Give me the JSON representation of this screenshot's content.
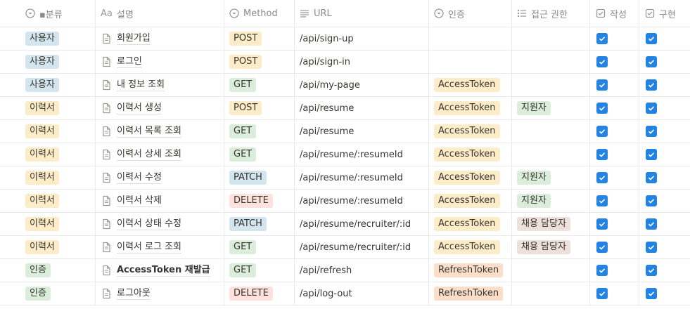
{
  "headers": {
    "category": "▪분류",
    "name": "설명",
    "method": "Method",
    "url": "URL",
    "auth": "인증",
    "access": "접근 권한",
    "written": "작성",
    "implemented": "구현"
  },
  "header_icon_text": {
    "name": "Aa"
  },
  "colors": {
    "사용자": "#d3e5ef",
    "이력서": "#fdecc8",
    "인증": "#dbeddb",
    "POST": "#fdecc8",
    "GET": "#dbeddb",
    "PATCH": "#d3e5ef",
    "DELETE": "#ffe2dd",
    "AccessToken": "#fdecc8",
    "RefreshToken": "#fadec9",
    "지원자": "#dbeddb",
    "채용 담당자": "#eee0da",
    "check": "#2383e2"
  },
  "rows": [
    {
      "category": "사용자",
      "name": "회원가입",
      "method": "POST",
      "url": "/api/sign-up",
      "auth": "",
      "access": "",
      "written": true,
      "implemented": true
    },
    {
      "category": "사용자",
      "name": "로그인",
      "method": "POST",
      "url": "/api/sign-in",
      "auth": "",
      "access": "",
      "written": true,
      "implemented": true
    },
    {
      "category": "사용자",
      "name": "내 정보 조회",
      "method": "GET",
      "url": "/api/my-page",
      "auth": "AccessToken",
      "access": "",
      "written": true,
      "implemented": true
    },
    {
      "category": "이력서",
      "name": "이력서 생성",
      "method": "POST",
      "url": "/api/resume",
      "auth": "AccessToken",
      "access": "지원자",
      "written": true,
      "implemented": true
    },
    {
      "category": "이력서",
      "name": "이력서 목록 조회",
      "method": "GET",
      "url": "/api/resume",
      "auth": "AccessToken",
      "access": "",
      "written": true,
      "implemented": true
    },
    {
      "category": "이력서",
      "name": "이력서 상세 조회",
      "method": "GET",
      "url": "/api/resume/:resumeId",
      "auth": "AccessToken",
      "access": "",
      "written": true,
      "implemented": true
    },
    {
      "category": "이력서",
      "name": "이력서 수정",
      "method": "PATCH",
      "url": "/api/resume/:resumeId",
      "auth": "AccessToken",
      "access": "지원자",
      "written": true,
      "implemented": true
    },
    {
      "category": "이력서",
      "name": "이력서 삭제",
      "method": "DELETE",
      "url": "/api/resume/:resumeId",
      "auth": "AccessToken",
      "access": "지원자",
      "written": true,
      "implemented": true
    },
    {
      "category": "이력서",
      "name": "이력서 상태 수정",
      "method": "PATCH",
      "url": "/api/resume/recruiter/:id",
      "auth": "AccessToken",
      "access": "채용 담당자",
      "written": true,
      "implemented": true
    },
    {
      "category": "이력서",
      "name": "이력서 로그 조회",
      "method": "GET",
      "url": "/api/resume/recruiter/:id",
      "auth": "AccessToken",
      "access": "채용 담당자",
      "written": true,
      "implemented": true
    },
    {
      "category": "인증",
      "name": "AccessToken 재발급",
      "method": "GET",
      "url": "/api/refresh",
      "auth": "RefreshToken",
      "access": "",
      "written": true,
      "implemented": true,
      "bold": true
    },
    {
      "category": "인증",
      "name": "로그아웃",
      "method": "DELETE",
      "url": "/api/log-out",
      "auth": "RefreshToken",
      "access": "",
      "written": true,
      "implemented": true
    }
  ]
}
